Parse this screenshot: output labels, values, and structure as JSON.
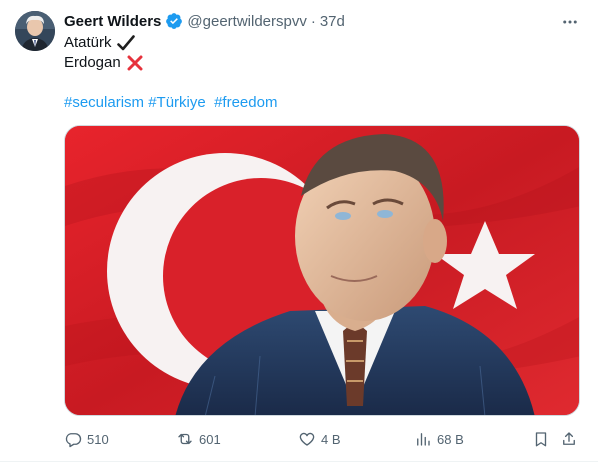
{
  "author": {
    "name": "Geert Wilders",
    "handle": "@geertwilderspvv",
    "separator": "·",
    "time": "37d",
    "verified_color": "#1d9bf0"
  },
  "post": {
    "line1": "Atatürk",
    "line1_emoji": "check-mark-icon",
    "line2": "Erdogan",
    "line2_emoji": "cross-mark-icon",
    "hashtags": [
      "#secularism",
      "#Türkiye",
      "#freedom"
    ]
  },
  "media": {
    "description_icons": [
      "turkish-flag",
      "portrait"
    ],
    "flag_color": "#d9212a"
  },
  "actions": {
    "replies": "510",
    "reposts": "601",
    "likes": "4 B",
    "views": "68 B"
  },
  "colors": {
    "text": "#0f1419",
    "muted": "#536471",
    "link": "#1d9bf0"
  }
}
